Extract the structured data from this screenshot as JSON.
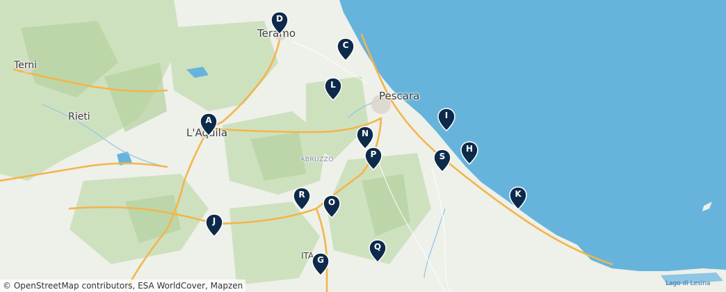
{
  "map": {
    "colors": {
      "sea": "#66b4dc",
      "land": "#eef0ea",
      "forest": "#c9dfb8",
      "motorway": "#f3b54a",
      "marker": "#0d2a4a"
    },
    "places": [
      {
        "id": "teramo",
        "name": "Teramo"
      },
      {
        "id": "terni",
        "name": "Terni"
      },
      {
        "id": "pescara",
        "name": "Pescara"
      },
      {
        "id": "rieti",
        "name": "Rieti"
      },
      {
        "id": "laquila",
        "name": "L'Aquila"
      },
      {
        "id": "abruzzo",
        "name": "ABRUZZO"
      },
      {
        "id": "ita",
        "name": "ITA"
      },
      {
        "id": "lago",
        "name": "Lago di Lesina"
      }
    ],
    "markers": [
      {
        "id": "D",
        "label": "D"
      },
      {
        "id": "C",
        "label": "C"
      },
      {
        "id": "L",
        "label": "L"
      },
      {
        "id": "A",
        "label": "A"
      },
      {
        "id": "I",
        "label": "I"
      },
      {
        "id": "N",
        "label": "N"
      },
      {
        "id": "H",
        "label": "H"
      },
      {
        "id": "P",
        "label": "P"
      },
      {
        "id": "S",
        "label": "S"
      },
      {
        "id": "K",
        "label": "K"
      },
      {
        "id": "R",
        "label": "R"
      },
      {
        "id": "O",
        "label": "O"
      },
      {
        "id": "J",
        "label": "J"
      },
      {
        "id": "Q",
        "label": "Q"
      },
      {
        "id": "G",
        "label": "G"
      }
    ],
    "attribution": "© OpenStreetMap contributors, ESA WorldCover, Mapzen"
  }
}
